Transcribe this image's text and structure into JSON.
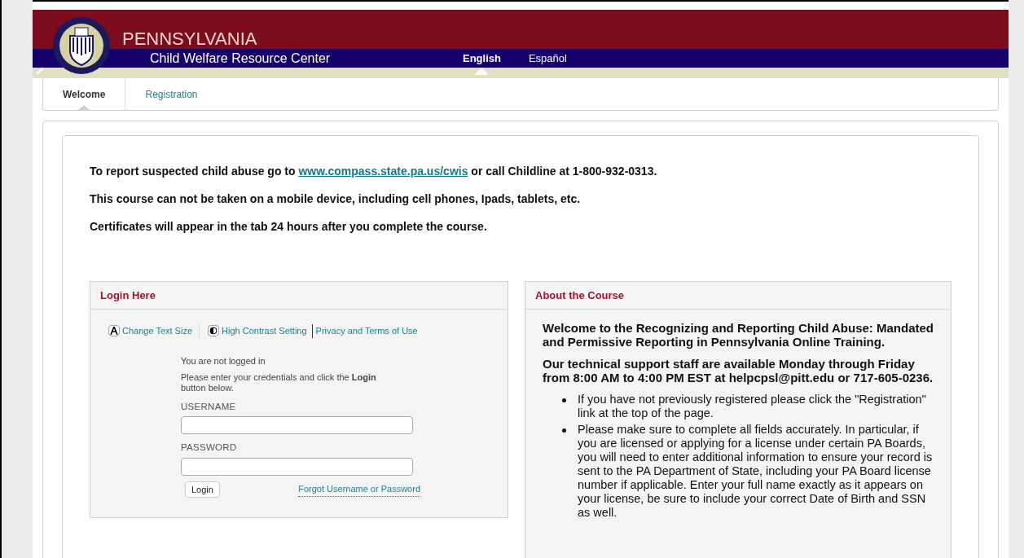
{
  "header": {
    "title": "PENNSYLVANIA",
    "subtitle": "Child Welfare Resource Center",
    "languages": [
      {
        "label": "English",
        "selected": true
      },
      {
        "label": "Español",
        "selected": false
      }
    ]
  },
  "tabs": [
    {
      "label": "Welcome",
      "selected": true
    },
    {
      "label": "Registration",
      "selected": false
    }
  ],
  "notices": [
    {
      "before": "To report suspected child abuse go to ",
      "link": "www.compass.state.pa.us/cwis",
      "after": " or call Childline at 1-800-932-0313."
    },
    {
      "before": "This course can not be taken on a mobile device, including cell phones, Ipads, tablets, etc."
    },
    {
      "before": "Certificates will appear in the tab 24 hours after you complete the course."
    }
  ],
  "login_panel": {
    "title": "Login Here",
    "tools": [
      {
        "kind": "text-size",
        "label": "Change Text Size"
      },
      {
        "kind": "contrast",
        "label": "High Contrast Setting"
      },
      {
        "kind": "plain",
        "label": "Privacy and Terms of Use"
      }
    ],
    "status": "You are not logged in",
    "instructions": "Please enter your credentials and click the **Login** button below.",
    "fields": [
      {
        "label": "USERNAME"
      },
      {
        "label": "PASSWORD"
      }
    ],
    "button": "Login",
    "forgot_link": "Forgot Username or Password"
  },
  "about_panel": {
    "title": "About the Course",
    "paragraphs": [
      "Welcome to the Recognizing and Reporting Child Abuse: Mandated and Permissive Reporting in Pennsylvania Online Training.",
      "Our technical support staff are available Monday through Friday from 8:00 AM to 4:00 PM EST at helpcpsl@pitt.edu or 717-605-0236."
    ],
    "bullets": [
      "If you have not previously registered please click the \"Registration\" link at the top of the page.",
      "Please make sure to complete all fields accurately. In particular, if you are licensed or applying for a license under certain PA Boards, you will need to enter additional information to ensure your record is sent to the PA Department of State, including your PA Board license number if applicable. Enter your full name exactly as it appears on your license, be sure to include your correct Date of Birth and SSN as well."
    ]
  }
}
